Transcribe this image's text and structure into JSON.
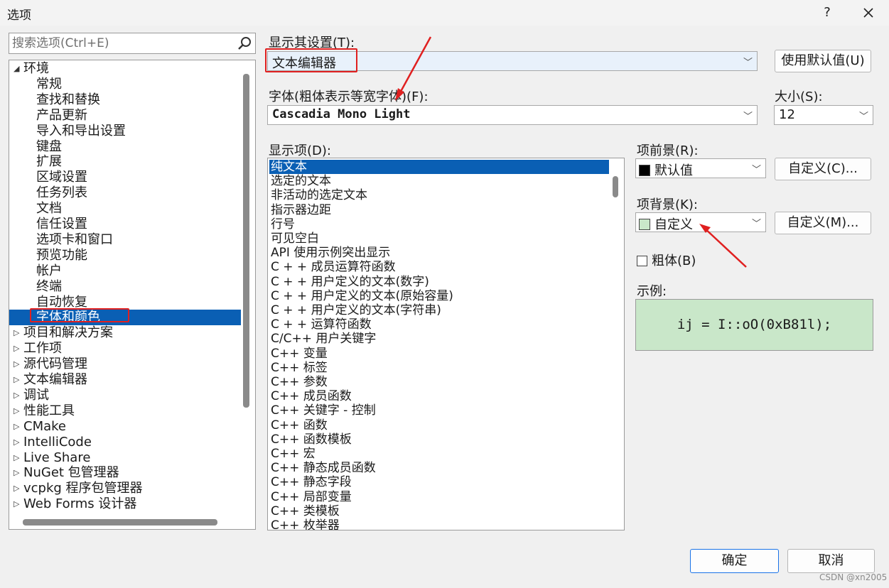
{
  "window": {
    "title": "选项",
    "help_label": "?",
    "close_label": "✕"
  },
  "search": {
    "placeholder": "搜索选项(Ctrl+E)"
  },
  "tree": {
    "items": [
      {
        "label": "环境",
        "arrow": "◢"
      },
      {
        "label": "常规"
      },
      {
        "label": "查找和替换"
      },
      {
        "label": "产品更新"
      },
      {
        "label": "导入和导出设置"
      },
      {
        "label": "键盘"
      },
      {
        "label": "扩展"
      },
      {
        "label": "区域设置"
      },
      {
        "label": "任务列表"
      },
      {
        "label": "文档"
      },
      {
        "label": "信任设置"
      },
      {
        "label": "选项卡和窗口"
      },
      {
        "label": "预览功能"
      },
      {
        "label": "帐户"
      },
      {
        "label": "终端"
      },
      {
        "label": "自动恢复"
      },
      {
        "label": "字体和颜色"
      },
      {
        "label": "项目和解决方案",
        "arrow": "▷"
      },
      {
        "label": "工作项",
        "arrow": "▷"
      },
      {
        "label": "源代码管理",
        "arrow": "▷"
      },
      {
        "label": "文本编辑器",
        "arrow": "▷"
      },
      {
        "label": "调试",
        "arrow": "▷"
      },
      {
        "label": "性能工具",
        "arrow": "▷"
      },
      {
        "label": "CMake",
        "arrow": "▷"
      },
      {
        "label": "IntelliCode",
        "arrow": "▷"
      },
      {
        "label": "Live Share",
        "arrow": "▷"
      },
      {
        "label": "NuGet 包管理器",
        "arrow": "▷"
      },
      {
        "label": "vcpkg 程序包管理器",
        "arrow": "▷"
      },
      {
        "label": "Web Forms 设计器",
        "arrow": "▷"
      }
    ]
  },
  "settings": {
    "show_settings_for_label": "显示其设置(T):",
    "show_settings_for_value": "文本编辑器",
    "use_defaults_label": "使用默认值(U)",
    "font_label": "字体(粗体表示等宽字体)(F):",
    "font_value": "Cascadia Mono Light",
    "size_label": "大小(S):",
    "size_value": "12",
    "display_items_label": "显示项(D):",
    "item_foreground_label": "项前景(R):",
    "item_foreground_value": "默认值",
    "item_foreground_color": "#000000",
    "custom_c_label": "自定义(C)...",
    "item_background_label": "项背景(K):",
    "item_background_value": "自定义",
    "item_background_color": "#c9e7c9",
    "custom_m_label": "自定义(M)...",
    "bold_label": "粗体(B)",
    "bold_checked": false,
    "sample_label": "示例:",
    "sample_text": "ij = I::oO(0xB81l);"
  },
  "display_items": [
    "纯文本",
    "选定的文本",
    "非活动的选定文本",
    "指示器边距",
    "行号",
    "可见空白",
    "API 使用示例突出显示",
    "C + + 成员运算符函数",
    "C + + 用户定义的文本(数字)",
    "C + + 用户定义的文本(原始容量)",
    "C + + 用户定义的文本(字符串)",
    "C + + 运算符函数",
    "C/C++ 用户关键字",
    "C++ 变量",
    "C++ 标签",
    "C++ 参数",
    "C++ 成员函数",
    "C++ 关键字 - 控制",
    "C++ 函数",
    "C++ 函数模板",
    "C++ 宏",
    "C++ 静态成员函数",
    "C++ 静态字段",
    "C++ 局部变量",
    "C++ 类模板",
    "C++ 枚举器"
  ],
  "footer": {
    "ok_label": "确定",
    "cancel_label": "取消",
    "watermark": "CSDN @xn2005"
  },
  "colors": {
    "selection": "#0a5fb4",
    "annotation_red": "#e02020"
  }
}
